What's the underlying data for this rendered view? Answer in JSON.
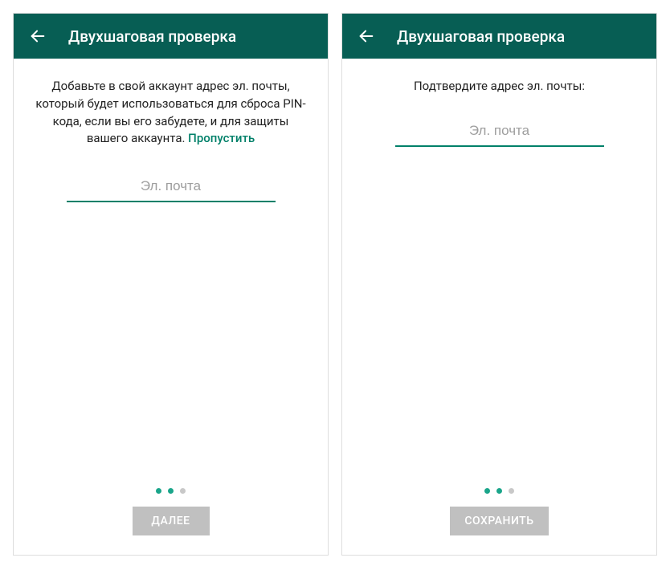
{
  "colors": {
    "accent": "#008069",
    "appbar": "#075e54",
    "btnDisabled": "#c0c0c0"
  },
  "screens": [
    {
      "title": "Двухшаговая проверка",
      "intro": "Добавьте в свой аккаунт адрес эл. почты, который будет использоваться для сброса PIN-кода, если вы его забудете, и для защиты вашего аккаунта. ",
      "skip": "Пропустить",
      "email_placeholder": "Эл. почта",
      "dots": {
        "total": 3,
        "active": 1
      },
      "button": "ДАЛЕЕ"
    },
    {
      "title": "Двухшаговая проверка",
      "intro": "Подтвердите адрес эл. почты:",
      "email_placeholder": "Эл. почта",
      "dots": {
        "total": 3,
        "active": 1
      },
      "button": "СОХРАНИТЬ"
    }
  ]
}
